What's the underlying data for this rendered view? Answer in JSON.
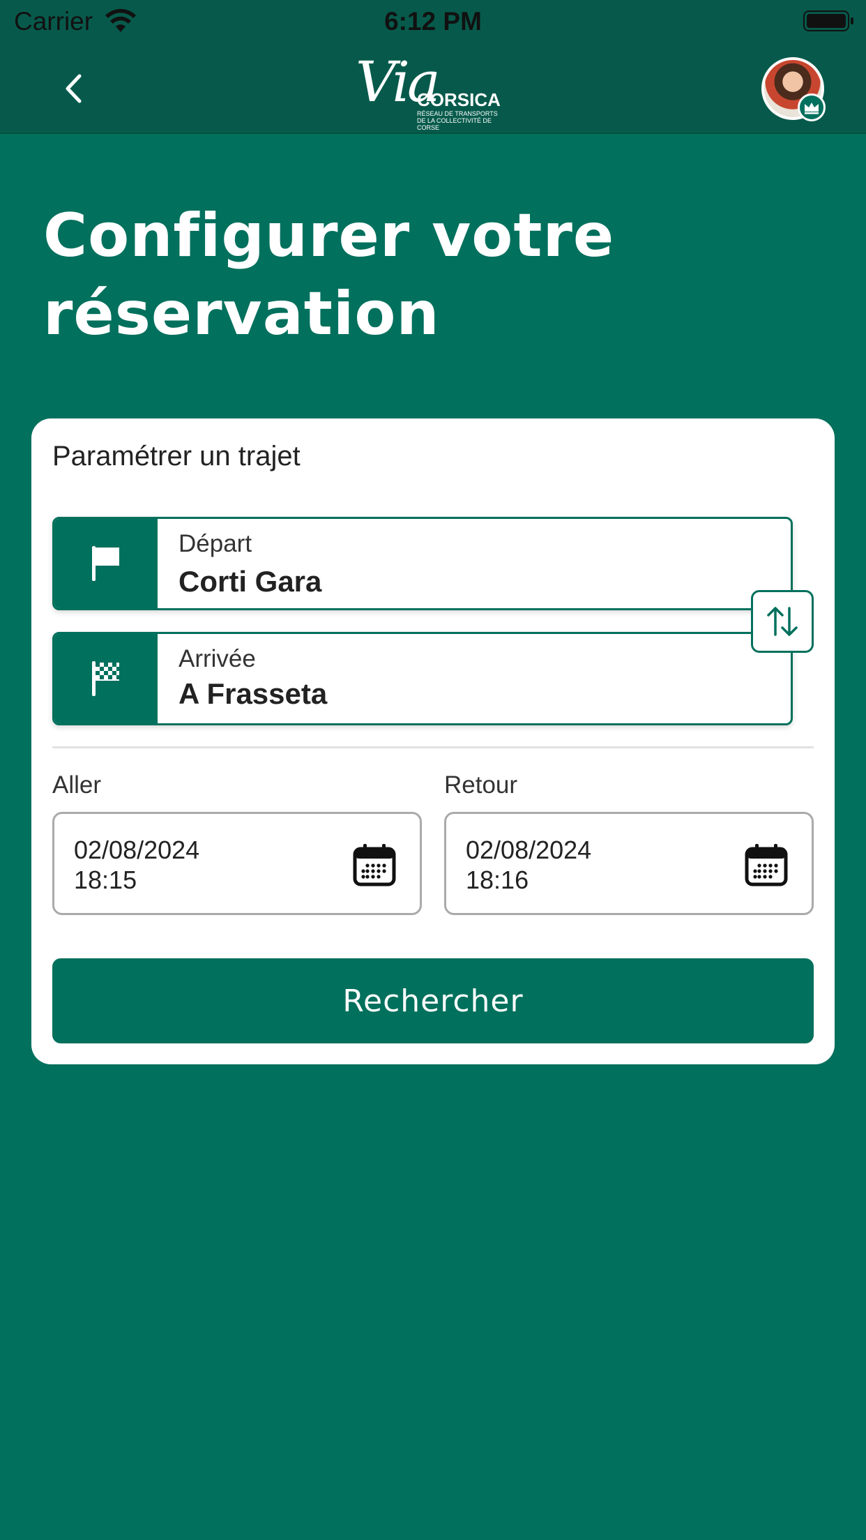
{
  "status_bar": {
    "carrier": "Carrier",
    "time": "6:12 PM"
  },
  "header": {
    "back_icon": "chevron-left-icon",
    "logo": {
      "via": "Via",
      "brand": "CORSICA",
      "tagline_line1": "RÉSEAU DE TRANSPORTS",
      "tagline_line2": "DE LA COLLECTIVITÉ DE CORSE"
    },
    "avatar_badge_icon": "crown-icon"
  },
  "page": {
    "title": "Configurer votre réservation"
  },
  "card": {
    "title": "Paramétrer un trajet",
    "departure": {
      "label": "Départ",
      "value": "Corti Gara",
      "icon": "flag-icon"
    },
    "arrival": {
      "label": "Arrivée",
      "value": "A Frasseta",
      "icon": "checkered-flag-icon"
    },
    "swap_icon": "swap-vertical-icon",
    "outbound": {
      "label": "Aller",
      "date": "02/08/2024",
      "time": "18:15"
    },
    "return": {
      "label": "Retour",
      "date": "02/08/2024",
      "time": "18:16"
    },
    "search_label": "Rechercher"
  },
  "colors": {
    "primary": "#01705d",
    "header": "#075a4b",
    "card_background": "#ffffff"
  }
}
